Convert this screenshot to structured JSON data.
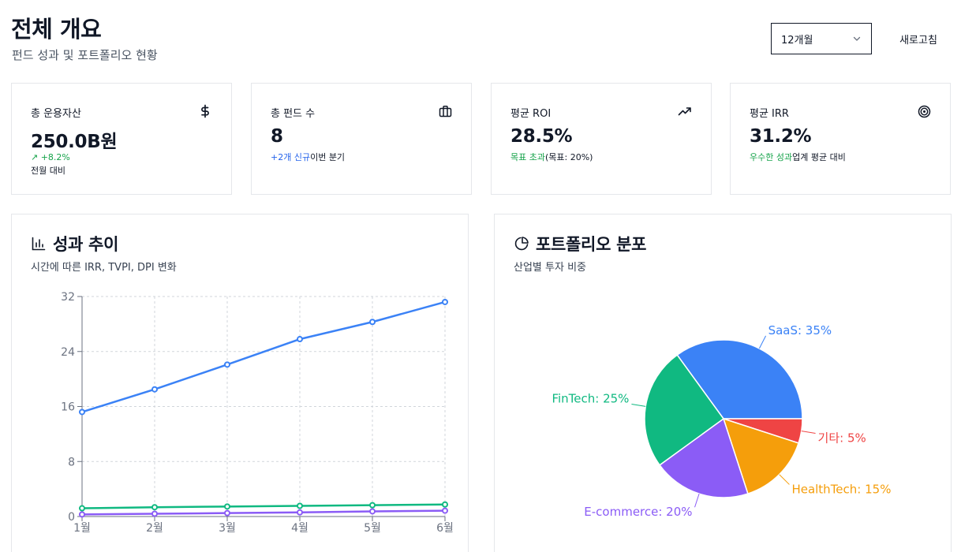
{
  "header": {
    "title": "전체 개요",
    "subtitle": "펀드 성과 및 포트폴리오 현황",
    "period_value": "12개월",
    "refresh_label": "새로고침"
  },
  "kpis": [
    {
      "title": "총 운용자산",
      "icon": "dollar-icon",
      "value": "250.0B원",
      "sub_highlight": "↗ +8.2%",
      "sub_text": "전월 대비",
      "highlight_color": "#16a34a"
    },
    {
      "title": "총 펀드 수",
      "icon": "briefcase-icon",
      "value": "8",
      "sub_highlight": "+2개 신규",
      "sub_text": "이번 분기",
      "highlight_color": "#2563eb"
    },
    {
      "title": "평균 ROI",
      "icon": "trending-up-icon",
      "value": "28.5%",
      "sub_highlight": "목표 초과",
      "sub_text": "(목표: 20%)",
      "highlight_color": "#16a34a"
    },
    {
      "title": "평균 IRR",
      "icon": "target-icon",
      "value": "31.2%",
      "sub_highlight": "우수한 성과",
      "sub_text": "업계 평균 대비",
      "highlight_color": "#16a34a"
    }
  ],
  "performance": {
    "title": "성과 추이",
    "subtitle": "시간에 따른 IRR, TVPI, DPI 변화"
  },
  "portfolio": {
    "title": "포트폴리오 분포",
    "subtitle": "산업별 투자 비중"
  },
  "chart_data": [
    {
      "type": "line",
      "categories": [
        "1월",
        "2월",
        "3월",
        "4월",
        "5월",
        "6월"
      ],
      "series": [
        {
          "values": [
            15.2,
            18.5,
            22.1,
            25.8,
            28.3,
            31.2
          ],
          "color": "#3b82f6"
        },
        {
          "values": [
            1.2,
            1.35,
            1.45,
            1.55,
            1.65,
            1.75
          ],
          "color": "#10b981"
        },
        {
          "values": [
            0.3,
            0.4,
            0.5,
            0.6,
            0.75,
            0.85
          ],
          "color": "#8b5cf6"
        }
      ],
      "yticks": [
        0,
        8,
        16,
        24,
        32
      ],
      "ylim": [
        0,
        32
      ],
      "grid": true
    },
    {
      "type": "pie",
      "slices": [
        {
          "label": "SaaS: 35%",
          "value": 35,
          "color": "#3b82f6"
        },
        {
          "label": "기타: 5%",
          "value": 5,
          "color": "#ef4444"
        },
        {
          "label": "HealthTech: 15%",
          "value": 15,
          "color": "#f59e0b"
        },
        {
          "label": "E-commerce: 20%",
          "value": 20,
          "color": "#8b5cf6"
        },
        {
          "label": "FinTech: 25%",
          "value": 25,
          "color": "#10b981"
        }
      ]
    }
  ]
}
